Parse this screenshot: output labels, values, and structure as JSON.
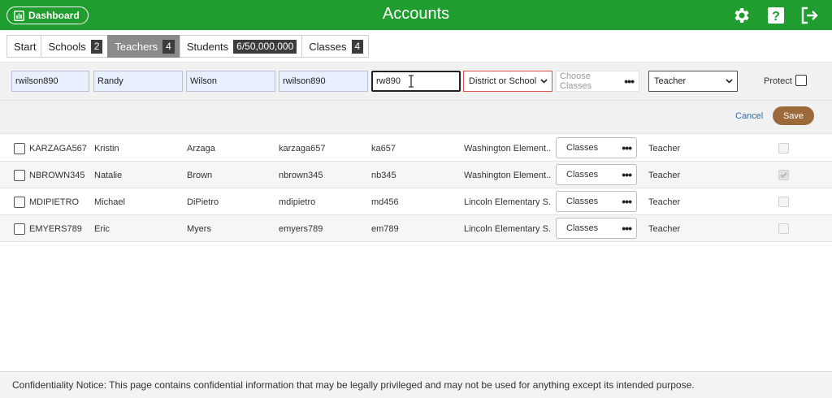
{
  "header": {
    "dashboard_label": "Dashboard",
    "title": "Accounts",
    "icons": [
      "gear-icon",
      "help-icon",
      "logout-icon"
    ]
  },
  "tabs": [
    {
      "label": "Start",
      "count": ""
    },
    {
      "label": "Schools",
      "count": "2"
    },
    {
      "label": "Teachers",
      "count": "4",
      "active": true
    },
    {
      "label": "Students",
      "count": "6/50,000,000"
    },
    {
      "label": "Classes",
      "count": "4"
    }
  ],
  "edit": {
    "username": "rwilson890",
    "first_name": "Randy",
    "last_name": "Wilson",
    "login": "rwilson890",
    "password": "rw890",
    "school_select": "District or School",
    "classes_placeholder": "Choose Classes",
    "role_select": "Teacher",
    "protect_label": "Protect"
  },
  "actions": {
    "cancel": "Cancel",
    "save": "Save"
  },
  "rows": [
    {
      "username": "KARZAGA567",
      "first": "Kristin",
      "last": "Arzaga",
      "login": "karzaga657",
      "password": "ka657",
      "school": "Washington Element...",
      "classes": "Classes",
      "role": "Teacher",
      "protected": false
    },
    {
      "username": "NBROWN345",
      "first": "Natalie",
      "last": "Brown",
      "login": "nbrown345",
      "password": "nb345",
      "school": "Washington Element...",
      "classes": "Classes",
      "role": "Teacher",
      "protected": true
    },
    {
      "username": "MDIPIETRO",
      "first": "Michael",
      "last": "DiPietro",
      "login": "mdipietro",
      "password": "md456",
      "school": "Lincoln Elementary S...",
      "classes": "Classes",
      "role": "Teacher",
      "protected": false
    },
    {
      "username": "EMYERS789",
      "first": "Eric",
      "last": "Myers",
      "login": "emyers789",
      "password": "em789",
      "school": "Lincoln Elementary S...",
      "classes": "Classes",
      "role": "Teacher",
      "protected": false
    }
  ],
  "footer": {
    "notice": "Confidentiality Notice: This page contains confidential information that may be legally privileged and may not be used for anything except its intended purpose."
  },
  "colors": {
    "header_green": "#1f9e2f",
    "save_brown": "#9c6a3a",
    "link_blue": "#2a6fa8",
    "error_red": "#d9534f"
  }
}
